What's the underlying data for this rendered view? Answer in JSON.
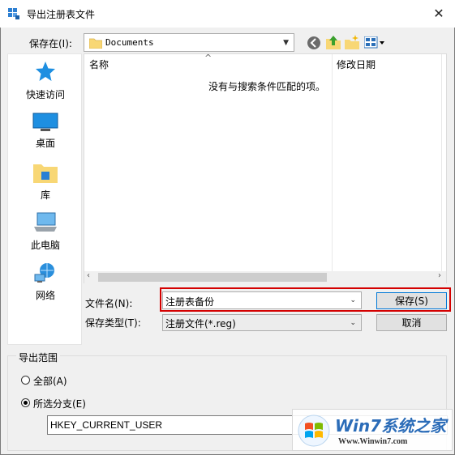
{
  "window": {
    "title": "导出注册表文件",
    "close_glyph": "✕"
  },
  "save_in": {
    "label": "保存在(I):",
    "value": "Documents"
  },
  "sidebar": {
    "items": [
      {
        "label": "快速访问",
        "icon": "star-icon"
      },
      {
        "label": "桌面",
        "icon": "desktop-icon"
      },
      {
        "label": "库",
        "icon": "library-icon"
      },
      {
        "label": "此电脑",
        "icon": "computer-icon"
      },
      {
        "label": "网络",
        "icon": "network-icon"
      }
    ]
  },
  "list": {
    "columns": [
      "名称",
      "修改日期"
    ],
    "empty_message": "没有与搜索条件匹配的项。",
    "sort_glyph": "^"
  },
  "filename": {
    "label": "文件名(N):",
    "value": "注册表备份"
  },
  "filetype": {
    "label": "保存类型(T):",
    "value": "注册文件(*.reg)"
  },
  "buttons": {
    "save": "保存(S)",
    "cancel": "取消"
  },
  "export_range": {
    "label": "导出范围",
    "options": [
      "全部(A)",
      "所选分支(E)"
    ],
    "selected": "所选分支(E)",
    "branch_value": "HKEY_CURRENT_USER"
  },
  "watermark": {
    "brand": "Win7系统之家",
    "url": "Www.Winwin7.com"
  },
  "colors": {
    "accent": "#0078d7",
    "highlight": "#d40000",
    "folder": "#f8d775"
  }
}
